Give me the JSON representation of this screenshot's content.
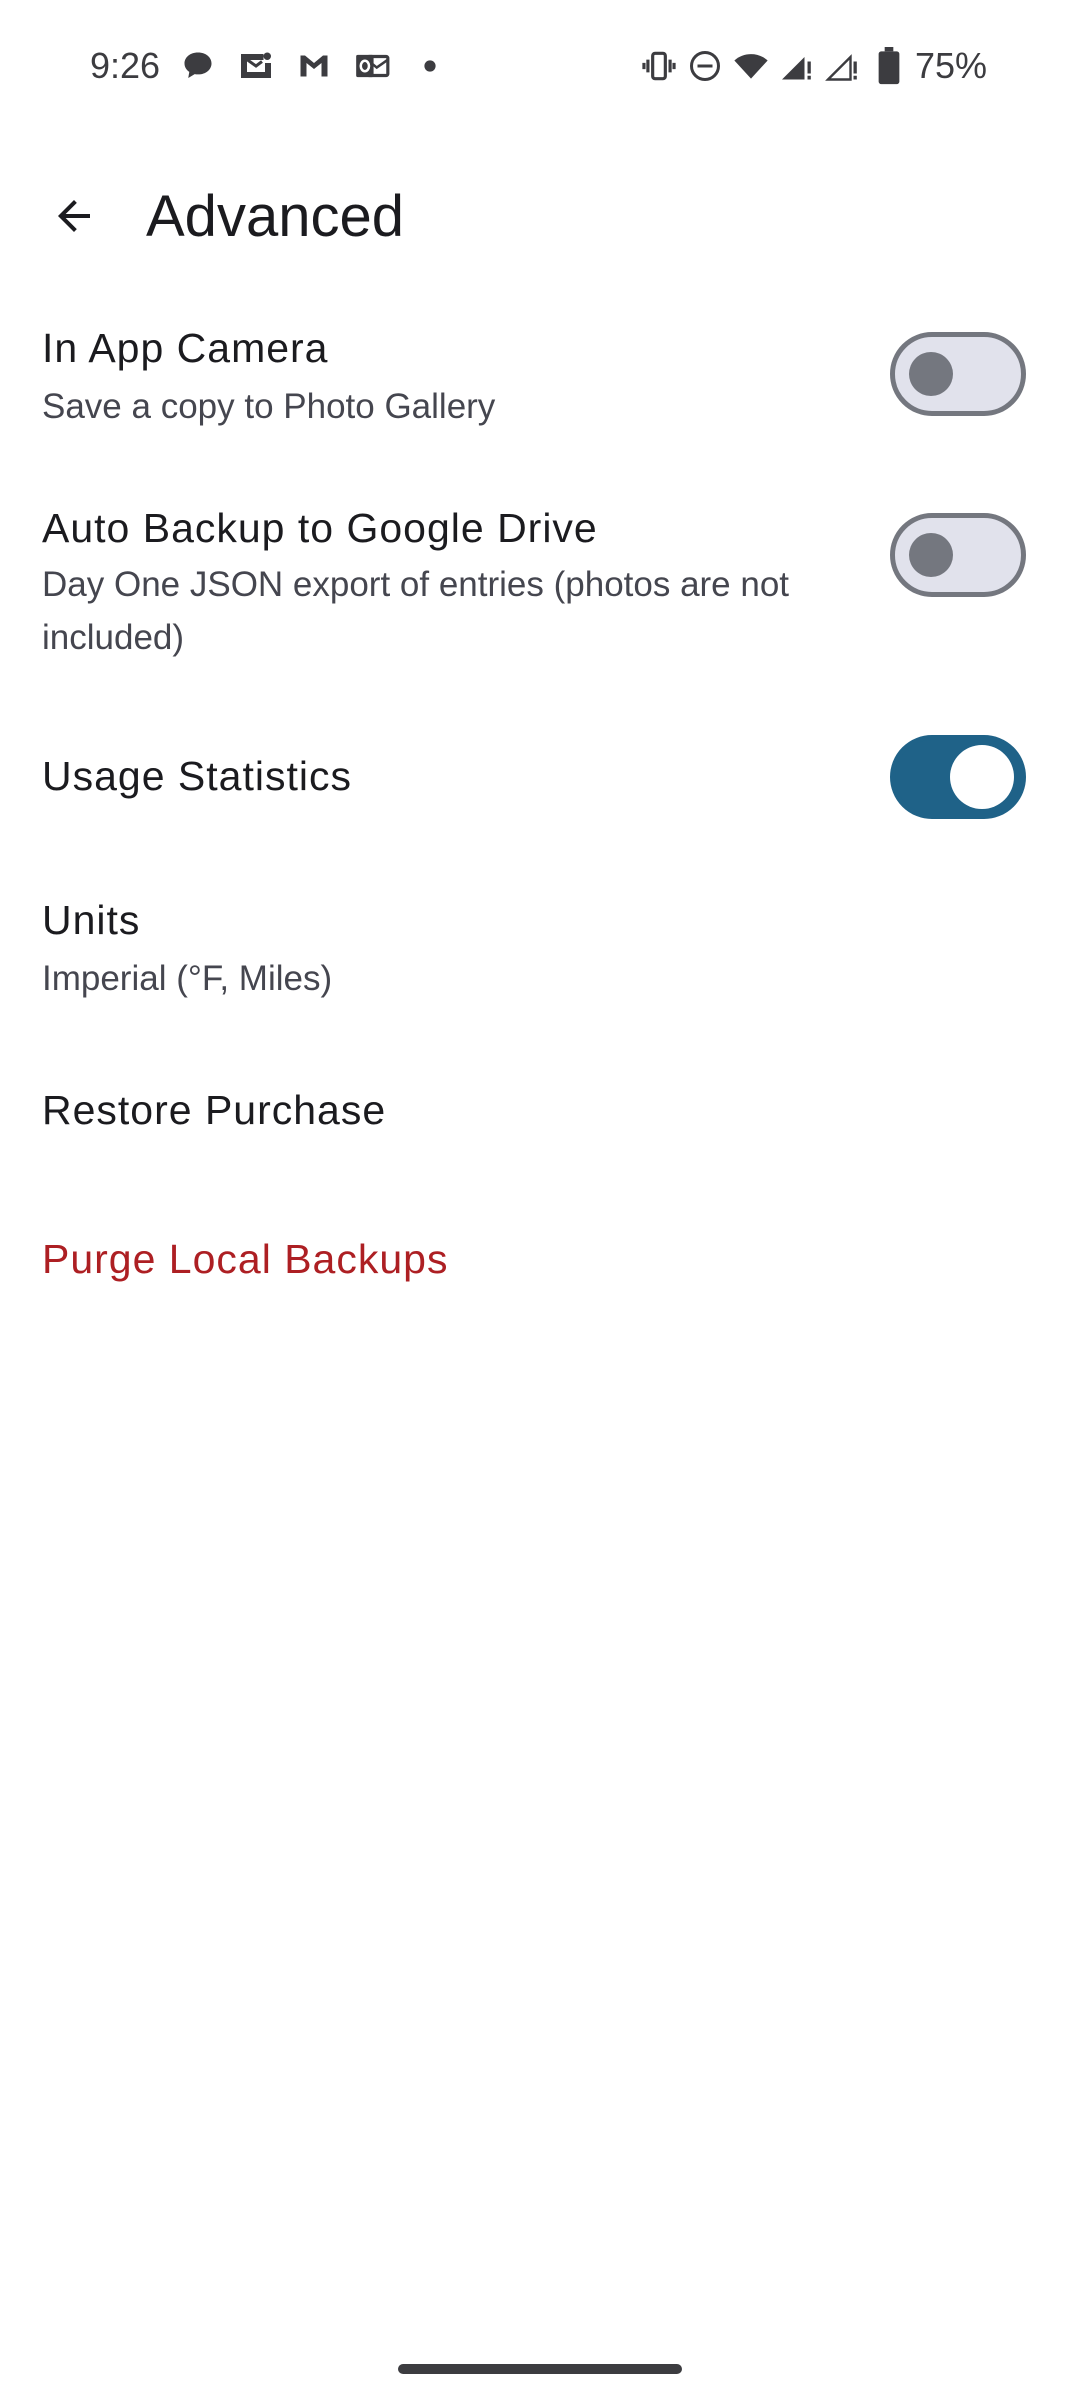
{
  "status_bar": {
    "time": "9:26",
    "left_icons": [
      "chat-bubble-icon",
      "mail-outline-icon",
      "gmail-icon",
      "outlook-icon",
      "dot-icon"
    ],
    "right_icons": [
      "vibrate-icon",
      "do-not-disturb-icon",
      "wifi-icon",
      "signal-icon",
      "signal-alt-icon",
      "battery-icon"
    ],
    "battery_percent": "75%"
  },
  "app_bar": {
    "back_icon": "arrow-back-icon",
    "title": "Advanced"
  },
  "settings": {
    "in_app_camera": {
      "title": "In App Camera",
      "summary": "Save a copy to Photo Gallery",
      "enabled": false
    },
    "auto_backup": {
      "title": "Auto Backup to Google Drive",
      "summary": "Day One JSON export of entries (photos are not included)",
      "enabled": false
    },
    "usage_statistics": {
      "title": "Usage Statistics",
      "enabled": true
    },
    "units": {
      "title": "Units",
      "summary": "Imperial (°F, Miles)"
    },
    "restore_purchase": {
      "title": "Restore Purchase"
    },
    "purge_local_backups": {
      "title": "Purge Local Backups"
    }
  },
  "colors": {
    "accent": "#1f6288",
    "danger": "#ad1f23",
    "switch_off_track": "#e1e2ec",
    "switch_off_outline": "#74777f",
    "text_primary": "#1b1b1f",
    "text_secondary": "#45464f"
  }
}
